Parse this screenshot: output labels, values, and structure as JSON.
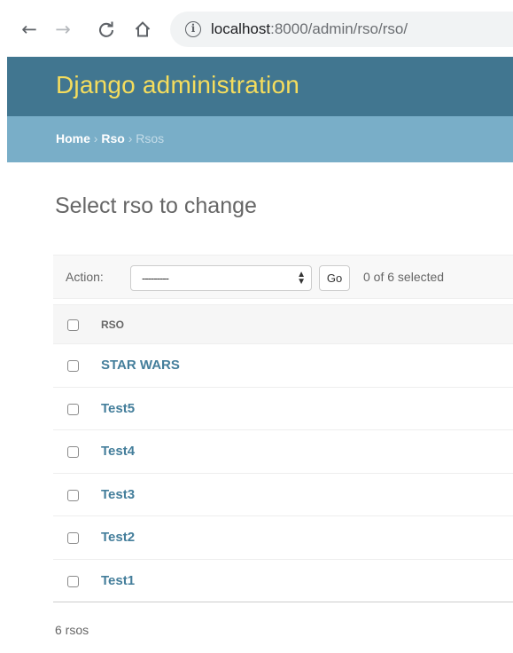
{
  "browser": {
    "back_icon": "←",
    "forward_icon": "→",
    "reload_icon": "C",
    "home_icon": "⌂",
    "info_icon": "i",
    "url_host": "localhost",
    "url_rest": ":8000/admin/rso/rso/"
  },
  "header": {
    "brand": "Django administration",
    "brand_color": "#f5dd5d",
    "background": "#417690"
  },
  "breadcrumbs": {
    "home": "Home",
    "sep": " › ",
    "app": "Rso",
    "current": "Rsos"
  },
  "content": {
    "title": "Select rso to change"
  },
  "actions": {
    "label": "Action:",
    "select_value": "---------",
    "go_label": "Go",
    "selected_count": "0 of 6 selected"
  },
  "table": {
    "column_header": "RSO",
    "rows": [
      "STAR WARS",
      "Test5",
      "Test4",
      "Test3",
      "Test2",
      "Test1"
    ]
  },
  "paginator": {
    "text": "6 rsos"
  }
}
